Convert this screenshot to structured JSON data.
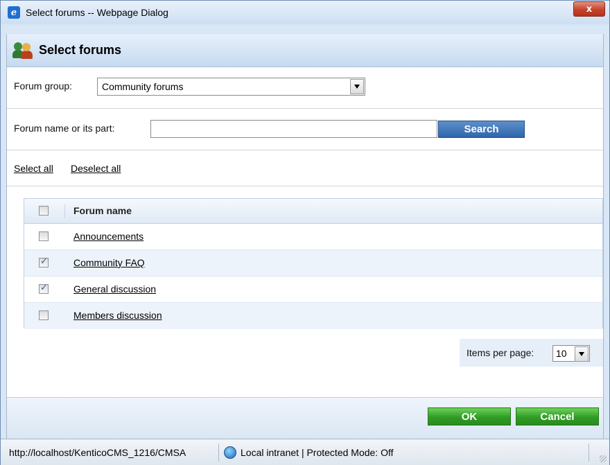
{
  "window": {
    "title": "Select forums -- Webpage Dialog",
    "close_label": "x"
  },
  "header": {
    "title": "Select forums"
  },
  "filter": {
    "group_label": "Forum group:",
    "group_value": "Community forums",
    "name_label": "Forum name or its part:",
    "name_value": "",
    "search_label": "Search"
  },
  "selection": {
    "select_all": "Select all",
    "deselect_all": "Deselect all"
  },
  "grid": {
    "column_header": "Forum name",
    "header_checked": false,
    "rows": [
      {
        "name": "Announcements",
        "checked": false
      },
      {
        "name": "Community FAQ",
        "checked": true
      },
      {
        "name": "General discussion",
        "checked": true
      },
      {
        "name": "Members discussion",
        "checked": false
      }
    ]
  },
  "pager": {
    "label": "Items per page:",
    "value": "10"
  },
  "footer": {
    "ok_label": "OK",
    "cancel_label": "Cancel"
  },
  "statusbar": {
    "url": "http://localhost/KenticoCMS_1216/CMSA",
    "zone": "Local intranet | Protected Mode: Off"
  },
  "colors": {
    "accent_blue": "#2f66ac",
    "ok_green": "#2f9c23"
  }
}
